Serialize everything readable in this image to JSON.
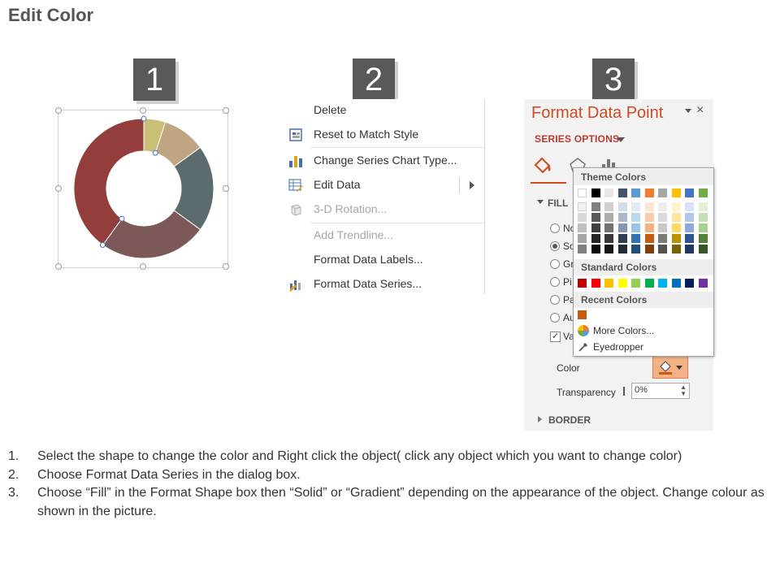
{
  "page": {
    "title": "Edit Color"
  },
  "steps": [
    "1",
    "2",
    "3"
  ],
  "chart": {
    "type": "donut",
    "slices": [
      {
        "value": 5,
        "color": "#c9c076"
      },
      {
        "value": 10,
        "color": "#c0a582"
      },
      {
        "value": 20,
        "color": "#5b6c6e"
      },
      {
        "value": 25,
        "color": "#7d5859"
      },
      {
        "value": 40,
        "color": "#943d3d"
      }
    ]
  },
  "context_menu": {
    "items": [
      {
        "label": "Delete",
        "icon": "none",
        "disabled": false
      },
      {
        "label": "Reset to Match Style",
        "icon": "reset-style-icon",
        "disabled": false
      },
      {
        "label": "Change Series Chart Type...",
        "icon": "bar-chart-icon",
        "disabled": false
      },
      {
        "label": "Edit Data",
        "icon": "edit-data-icon",
        "disabled": false,
        "submenu": true
      },
      {
        "label": "3-D Rotation...",
        "icon": "cube-icon",
        "disabled": true
      },
      {
        "label": "Add Trendline...",
        "icon": "none",
        "disabled": true
      },
      {
        "label": "Format Data Labels...",
        "icon": "none",
        "disabled": false
      },
      {
        "label": "Format Data Series...",
        "icon": "format-series-icon",
        "disabled": false
      }
    ]
  },
  "format_pane": {
    "title": "Format Data Point",
    "close": "×",
    "series_options": "SERIES OPTIONS",
    "fill_section": "FILL",
    "fill_options": [
      {
        "label": "No",
        "checked": false
      },
      {
        "label": "So",
        "checked": true
      },
      {
        "label": "Gr",
        "checked": false
      },
      {
        "label": "Pi",
        "checked": false
      },
      {
        "label": "Pa",
        "checked": false
      },
      {
        "label": "Au",
        "checked": false
      }
    ],
    "vary_label": "Va",
    "color_label": "Color",
    "transparency_label": "Transparency",
    "transparency_value": "0%",
    "border_section": "BORDER"
  },
  "color_picker": {
    "theme_header": "Theme Colors",
    "standard_header": "Standard Colors",
    "recent_header": "Recent Colors",
    "more_colors": "More Colors...",
    "eyedropper": "Eyedropper",
    "theme_top": [
      "#ffffff",
      "#000000",
      "#e7e6e6",
      "#44546a",
      "#5b9bd5",
      "#ed7d31",
      "#a5a5a5",
      "#ffc000",
      "#4472c4",
      "#70ad47"
    ],
    "theme_shades": [
      [
        "#f2f2f2",
        "#7f7f7f",
        "#d0cece",
        "#d6dce4",
        "#deebf6",
        "#fbe5d5",
        "#ededed",
        "#fff2cc",
        "#dae3f3",
        "#e2efd9"
      ],
      [
        "#d8d8d8",
        "#595959",
        "#aeabab",
        "#adb9ca",
        "#bdd7ee",
        "#f7cbac",
        "#dbdbdb",
        "#fee599",
        "#b4c6e7",
        "#c5e0b3"
      ],
      [
        "#bfbfbf",
        "#3f3f3f",
        "#757070",
        "#8496b0",
        "#9cc3e5",
        "#f4b183",
        "#c9c9c9",
        "#ffd965",
        "#8eaadb",
        "#a8d08d"
      ],
      [
        "#a5a5a5",
        "#262626",
        "#3a3838",
        "#323f4f",
        "#2e75b5",
        "#c55a11",
        "#7b7b7b",
        "#bf9000",
        "#2f5496",
        "#538135"
      ],
      [
        "#7f7f7f",
        "#0c0c0c",
        "#171616",
        "#222a35",
        "#1e4e79",
        "#843c0b",
        "#525252",
        "#7f6000",
        "#1f3864",
        "#375623"
      ]
    ],
    "standard": [
      "#c00000",
      "#ff0000",
      "#ffc000",
      "#ffff00",
      "#92d050",
      "#00b050",
      "#00b0f0",
      "#0070c0",
      "#002060",
      "#7030a0"
    ],
    "recent": [
      "#c55a11"
    ]
  },
  "instructions": [
    {
      "num": "1.",
      "text": "Select the shape to change the color and Right click the object( click any object which you want to change color)"
    },
    {
      "num": "2.",
      "text": "Choose Format Data Series in the dialog box."
    },
    {
      "num": "3.",
      "text": "Choose “Fill” in the Format Shape box then “Solid” or “Gradient” depending on the appearance of the object. Change colour as shown in the picture."
    }
  ]
}
